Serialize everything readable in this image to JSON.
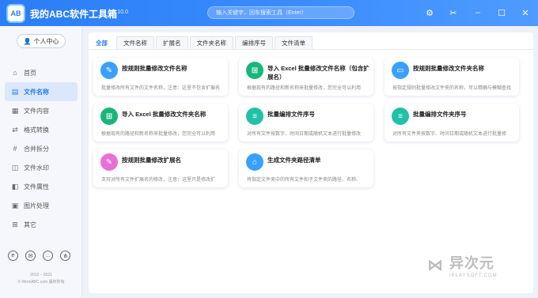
{
  "app": {
    "logo_text": "AB",
    "title": "我的ABC软件工具箱",
    "version": "v6.10.0",
    "search_placeholder": "输入关键字，回车搜索工具（Enter）",
    "accent": "#2a7df4"
  },
  "titlebar_icons": [
    "settings-icon",
    "skin-icon",
    "minimize-icon",
    "maximize-icon",
    "close-icon"
  ],
  "sidebar": {
    "user_button": "个人中心",
    "items": [
      {
        "label": "首页",
        "icon": "home-icon",
        "active": false
      },
      {
        "label": "文件名称",
        "icon": "file-name-icon",
        "active": true
      },
      {
        "label": "文件内容",
        "icon": "file-content-icon",
        "active": false
      },
      {
        "label": "格式转换",
        "icon": "format-convert-icon",
        "active": false
      },
      {
        "label": "合并拆分",
        "icon": "merge-split-icon",
        "active": false
      },
      {
        "label": "文件水印",
        "icon": "watermark-icon",
        "active": false
      },
      {
        "label": "文件属性",
        "icon": "attribute-icon",
        "active": false
      },
      {
        "label": "图片处理",
        "icon": "image-icon",
        "active": false
      },
      {
        "label": "其它",
        "icon": "other-icon",
        "active": false
      }
    ],
    "social_icons": [
      "weibo-icon",
      "mail-icon",
      "chat-icon",
      "share-icon"
    ],
    "copyright_years": "2013 – 2021",
    "copyright_text": "© WorkABC.com 版权所有"
  },
  "tabs": [
    "全部",
    "文件名称",
    "扩展名",
    "文件夹名称",
    "编排序号",
    "文件清单"
  ],
  "cards": [
    {
      "title": "按规则批量修改文件名称",
      "desc": "批量修改所有文件的文件名称，注意：这里不包含扩展名",
      "color": "#3aa0ff",
      "icon": "✎"
    },
    {
      "title": "导入 Excel 批量修改文件名称（包含扩展名）",
      "desc": "根据现有的路径和新名称来批量修改，您完全可以利用",
      "color": "#19b67a",
      "icon": "⊞"
    },
    {
      "title": "按规则批量修改文件夹名称",
      "desc": "按指定规则批量修改文件夹的名称，可以精确与模糊查找",
      "color": "#3aa0ff",
      "icon": "▭"
    },
    {
      "title": "导入 Excel 批量修改文件夹名称",
      "desc": "根据现有的路径和新名称来批量修改，您完全可以利用",
      "color": "#19b67a",
      "icon": "⊞"
    },
    {
      "title": "批量编排文件序号",
      "desc": "对所有文件按数字、时间日期或随机文本进行批量修改",
      "color": "#22c1a6",
      "icon": "≡"
    },
    {
      "title": "批量编排文件夹序号",
      "desc": "对所有文件夹按数字、时间日期或随机文本进行批量修",
      "color": "#22c1a6",
      "icon": "≡"
    },
    {
      "title": "按规则批量修改扩展名",
      "desc": "支持对所有文件扩展名的修改，注意：这里只是修改扩",
      "color": "#e86fd3",
      "icon": "✎"
    },
    {
      "title": "生成文件夹路径清单",
      "desc": "将指定文件夹中的所有文件和子文件夹的路径、名称、",
      "color": "#3aa0ff",
      "icon": "⌂"
    }
  ],
  "watermark": {
    "main": "异次元",
    "sub": "IPLAYSOFT.COM"
  }
}
